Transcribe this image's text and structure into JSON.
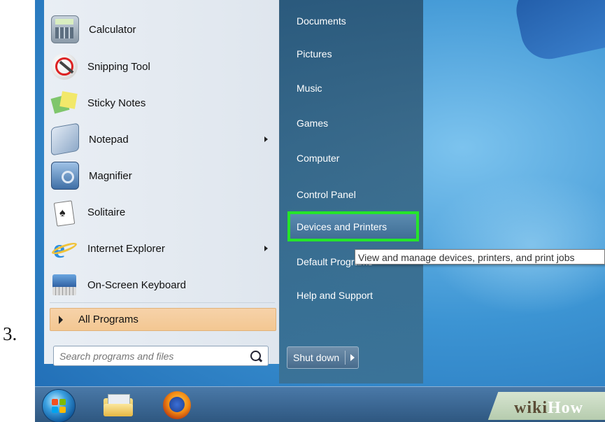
{
  "step_number": "3.",
  "start_menu": {
    "programs": [
      {
        "label": "Calculator",
        "icon": "calculator-icon",
        "has_arrow": false
      },
      {
        "label": "Snipping Tool",
        "icon": "scissors-icon",
        "has_arrow": false
      },
      {
        "label": "Sticky Notes",
        "icon": "sticky-notes-icon",
        "has_arrow": false
      },
      {
        "label": "Notepad",
        "icon": "notepad-icon",
        "has_arrow": true
      },
      {
        "label": "Magnifier",
        "icon": "magnifier-icon",
        "has_arrow": false
      },
      {
        "label": "Solitaire",
        "icon": "solitaire-icon",
        "has_arrow": false
      },
      {
        "label": "Internet Explorer",
        "icon": "internet-explorer-icon",
        "has_arrow": true
      },
      {
        "label": "On-Screen Keyboard",
        "icon": "keyboard-icon",
        "has_arrow": false
      }
    ],
    "all_programs": "All Programs",
    "search_placeholder": "Search programs and files",
    "right_links": [
      "Documents",
      "Pictures",
      "Music",
      "Games",
      "Computer",
      "Control Panel",
      "Devices and Printers",
      "Default Programs",
      "Help and Support"
    ],
    "highlighted_link": "Devices and Printers",
    "shutdown_label": "Shut down",
    "tooltip": "View and manage devices, printers, and print jobs"
  },
  "taskbar": {
    "items": [
      "start-orb-icon",
      "windows-explorer-icon",
      "firefox-icon"
    ]
  },
  "watermark": {
    "part1": "wiki",
    "part2": "How"
  },
  "colors": {
    "highlight_border": "#25e52a",
    "all_programs_bg": "#f3c792"
  }
}
